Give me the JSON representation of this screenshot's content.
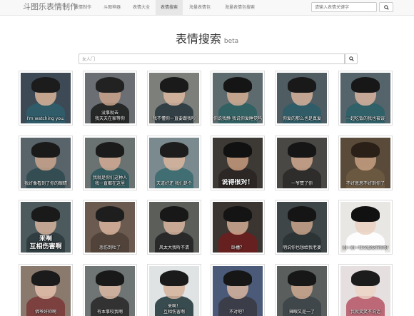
{
  "navbar": {
    "brand": "斗图乐表情制作",
    "items": [
      {
        "label": "表情制作",
        "active": false
      },
      {
        "label": "斗图神器",
        "active": false
      },
      {
        "label": "表情大全",
        "active": false
      },
      {
        "label": "表情搜索",
        "active": true
      },
      {
        "label": "海量表情包",
        "active": false
      },
      {
        "label": "海量表情包搜索",
        "active": false
      }
    ],
    "search_placeholder": "请输入表情关键字"
  },
  "page": {
    "title": "表情搜索",
    "badge": "beta"
  },
  "search": {
    "value": "女人门"
  },
  "grid": [
    {
      "caption": "I'm watching you.",
      "style": "small",
      "bg": "#3d4a55",
      "skin": "#d9b49a",
      "hair": "#1c1c1c",
      "cloth": "#2f5d6b"
    },
    {
      "caption": "没事就去\n我天天在家等你",
      "style": "small",
      "bg": "#6b6f73",
      "skin": "#c9a38b",
      "hair": "#222222",
      "cloth": "#1f1f1f"
    },
    {
      "caption": "我不懂你一直要跟我吵",
      "style": "small",
      "bg": "#7d7f7a",
      "skin": "#dcb7a0",
      "hair": "#1a1a1a",
      "cloth": "#2a3a40"
    },
    {
      "caption": "你说我静 我说你爱睡觉吗",
      "style": "small",
      "bg": "#5d6b6e",
      "skin": "#d3ad94",
      "hair": "#151515",
      "cloth": "#2e6062"
    },
    {
      "caption": "你爱的那么也是真爱",
      "style": "small",
      "bg": "#4f5d63",
      "skin": "#d6b09a",
      "hair": "#191919",
      "cloth": "#2b5c66"
    },
    {
      "caption": "一起吃饭的我也被误",
      "style": "small",
      "bg": "#55646a",
      "skin": "#d8b39d",
      "hair": "#171717",
      "cloth": "#2c5f68"
    },
    {
      "caption": "我好像看到了你的眼睛",
      "style": "small",
      "bg": "#58636a",
      "skin": "#caa48c",
      "hair": "#1a1a1a",
      "cloth": "#314a50"
    },
    {
      "caption": "我就是你们这种人\n我一直都在这里",
      "style": "small",
      "bg": "#6a7372",
      "skin": "#d2ac95",
      "hair": "#1b1b1b",
      "cloth": "#2d585c"
    },
    {
      "caption": "天道好还 我们是个",
      "style": "small",
      "bg": "#7a8a8e",
      "skin": "#dbb69f",
      "hair": "#1d1d1d",
      "cloth": "#3a6a70"
    },
    {
      "caption": "说得很对！",
      "style": "big",
      "bg": "#3d3a36",
      "skin": "#c79a7e",
      "hair": "#111111",
      "cloth": "#2a2622"
    },
    {
      "caption": "一爷赞了你",
      "style": "small",
      "bg": "#4a4845",
      "skin": "#d0a98e",
      "hair": "#161616",
      "cloth": "#2b2a28"
    },
    {
      "caption": "不好意思不好到你了",
      "style": "small",
      "bg": "#5a4a3a",
      "skin": "#c7a083",
      "hair": "#2a2018",
      "cloth": "#6b5a42"
    },
    {
      "caption": "来啊\n互相伤害啊",
      "style": "big",
      "bg": "#4c5a5e",
      "skin": "#d6b39b",
      "hair": "#1a1a1a",
      "cloth": "#2e3a3e"
    },
    {
      "caption": "悲伤到吐了",
      "style": "small",
      "bg": "#6a5a4f",
      "skin": "#d9b49c",
      "hair": "#1e1e1e",
      "cloth": "#4f4036"
    },
    {
      "caption": "风太大我听不清",
      "style": "small",
      "bg": "#5c5e5a",
      "skin": "#d8b5a0",
      "hair": "#181818",
      "cloth": "#232323"
    },
    {
      "caption": "卧槽？",
      "style": "small",
      "bg": "#3a3530",
      "skin": "#d1ac93",
      "hair": "#141414",
      "cloth": "#6a1e1e"
    },
    {
      "caption": "明说你也想给我老婆",
      "style": "small",
      "bg": "#3f4648",
      "skin": "#c9a38a",
      "hair": "#151515",
      "cloth": "#2a3234"
    },
    {
      "caption": "别~别~每次都觉得你好",
      "style": "small",
      "bg": "#e9e7e4",
      "skin": "#ead0bf",
      "hair": "#111111",
      "cloth": "#ffffff"
    },
    {
      "caption": "佛爷好帅啊",
      "style": "small",
      "bg": "#8a7a6e",
      "skin": "#e3c1ac",
      "hair": "#1b1b1b",
      "cloth": "#7a3a3a"
    },
    {
      "caption": "有本事咬我啊",
      "style": "small",
      "bg": "#6f7474",
      "skin": "#dcb9a3",
      "hair": "#191919",
      "cloth": "#2b2b2b"
    },
    {
      "caption": "来啊！\n互相伤害啊",
      "style": "small",
      "bg": "#dfe3e4",
      "skin": "#d6b39b",
      "hair": "#1a1a1a",
      "cloth": "#263a3e"
    },
    {
      "caption": "不对吧？",
      "style": "small",
      "bg": "#4a5a78",
      "skin": "#d8b6a0",
      "hair": "#161616",
      "cloth": "#3a3a44"
    },
    {
      "caption": "辣眼又是一了",
      "style": "small",
      "bg": "#5a5f5e",
      "skin": "#cfa990",
      "hair": "#171717",
      "cloth": "#3c4548"
    },
    {
      "caption": "我就笑笑不说话",
      "style": "small",
      "bg": "#e6dfe0",
      "skin": "#ecd3c4",
      "hair": "#1c1c1c",
      "cloth": "#b85b6a"
    }
  ]
}
